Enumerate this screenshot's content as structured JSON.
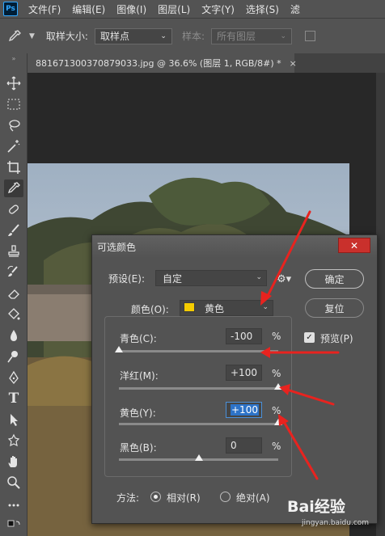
{
  "app": {
    "logo": "Ps"
  },
  "menu": [
    "文件(F)",
    "编辑(E)",
    "图像(I)",
    "图层(L)",
    "文字(Y)",
    "选择(S)",
    "滤"
  ],
  "options": {
    "tool_icon": "eyedropper-icon",
    "sample_size_label": "取样大小:",
    "sample_size_value": "取样点",
    "sample_label": "样本:",
    "sample_value": "所有图层"
  },
  "document_tab": {
    "title": "881671300370879033.jpg @ 36.6% (图层 1, RGB/8#) *",
    "close": "×"
  },
  "dialog": {
    "title": "可选颜色",
    "close": "✕",
    "preset_label": "预设(E):",
    "preset_value": "自定",
    "colors_label": "颜色(O):",
    "colors_value": "黄色",
    "swatch_color": "#f5cc00",
    "ok_label": "确定",
    "reset_label": "复位",
    "preview_label": "预览(P)",
    "preview_checked": true,
    "sliders": [
      {
        "label": "青色(C):",
        "value": "-100",
        "level_pct": -100
      },
      {
        "label": "洋红(M):",
        "value": "+100",
        "level_pct": 100
      },
      {
        "label": "黄色(Y):",
        "value": "+100",
        "level_pct": 100
      },
      {
        "label": "黑色(B):",
        "value": "0",
        "level_pct": 0
      }
    ],
    "percent": "%",
    "method_label": "方法:",
    "method_relative": "相对(R)",
    "method_absolute": "绝对(A)",
    "method_selected": "relative"
  },
  "watermark": {
    "brand": "Bai经验",
    "url": "jingyan.baidu.com"
  },
  "annotation_color": "#e8231f"
}
